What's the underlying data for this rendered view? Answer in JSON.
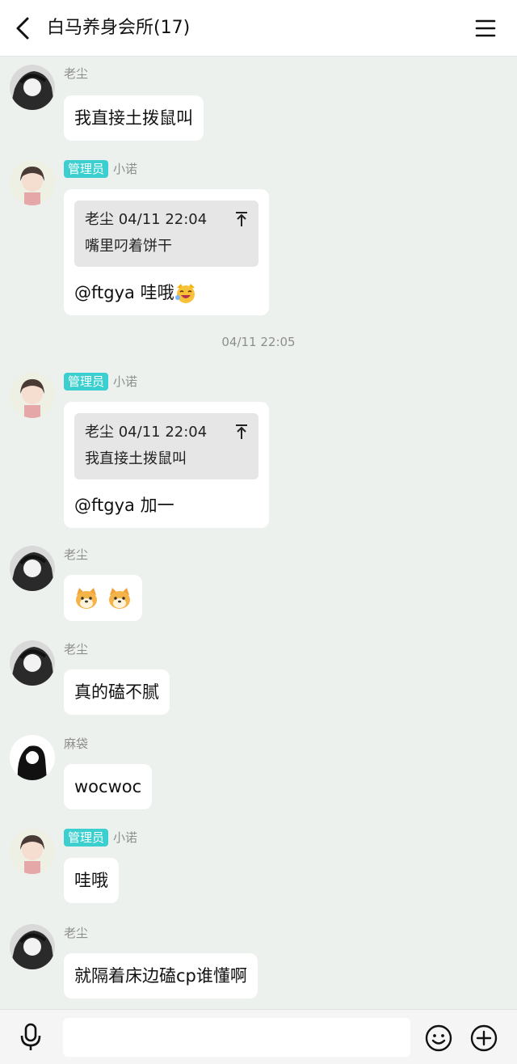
{
  "header": {
    "title": "白马养身会所(17)",
    "back_icon": "chevron-left-icon",
    "menu_icon": "hamburger-menu-icon"
  },
  "colors": {
    "background": "#edf1ee",
    "bubble": "#ffffff",
    "admin_badge": "#3ccfd0",
    "quote_bg": "#e6e6e6"
  },
  "timestamp": "04/11 22:05",
  "messages": [
    {
      "sender": "老尘",
      "text": "我直接土拨鼠叫"
    },
    {
      "sender": "小诺",
      "badge": "管理员",
      "quote": {
        "meta": "老尘 04/11 22:04",
        "text": "嘴里叼着饼干"
      },
      "mention": "@ftgya",
      "text": "哇哦",
      "emoji": "laughing-cat-emoji"
    },
    {
      "sender": "小诺",
      "badge": "管理员",
      "quote": {
        "meta": "老尘 04/11 22:04",
        "text": "我直接土拨鼠叫"
      },
      "mention": "@ftgya",
      "text": "加一"
    },
    {
      "sender": "老尘",
      "emoji": "shiba-dog-emoji x2"
    },
    {
      "sender": "老尘",
      "text": "真的磕不腻"
    },
    {
      "sender": "麻袋",
      "text": "wocwoc"
    },
    {
      "sender": "小诺",
      "badge": "管理员",
      "text": "哇哦"
    },
    {
      "sender": "老尘",
      "text": "就隔着床边磕cp谁懂啊"
    }
  ],
  "input": {
    "value": "",
    "placeholder": ""
  },
  "input_icons": [
    "microphone-icon",
    "smile-icon",
    "plus-icon"
  ]
}
